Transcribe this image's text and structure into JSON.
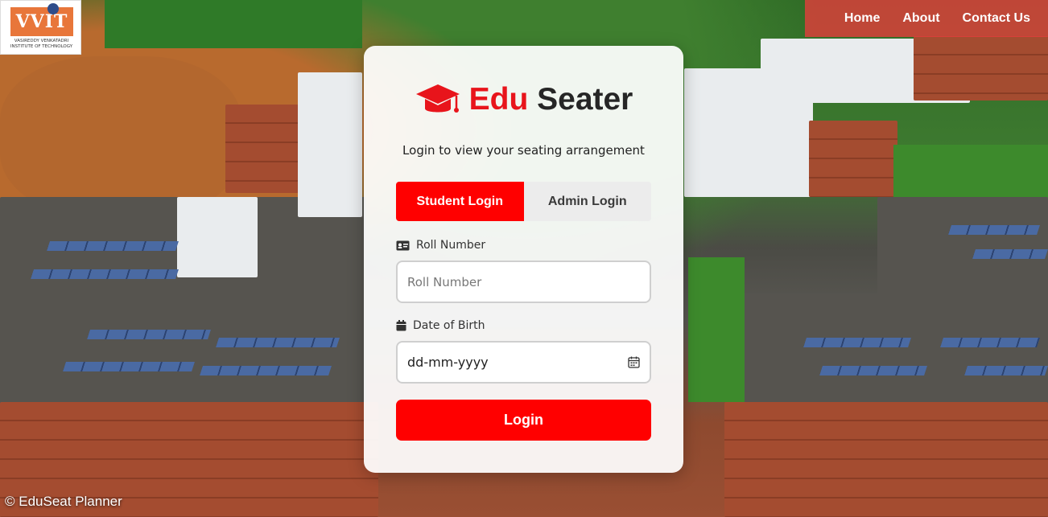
{
  "logo": {
    "badge_text": "VVIT",
    "subtitle": "VASIREDDY VENKATADRI INSTITUTE OF TECHNOLOGY"
  },
  "nav": {
    "items": [
      "Home",
      "About",
      "Contact Us"
    ]
  },
  "brand": {
    "part1": "Edu",
    "part2": " Seater",
    "icon": "graduation-cap-icon"
  },
  "login": {
    "subtitle": "Login to view your seating arrangement",
    "tabs": {
      "student": "Student Login",
      "admin": "Admin Login",
      "active": "student"
    },
    "roll_label": "Roll Number",
    "roll_placeholder": "Roll Number",
    "dob_label": "Date of Birth",
    "dob_value": "dd-mm-yyyy",
    "submit_label": "Login"
  },
  "footer": {
    "text": "© EduSeat Planner"
  },
  "colors": {
    "accent": "#ff0000",
    "brand_red": "#e8141b",
    "nav_bg": "#e83c3c"
  }
}
